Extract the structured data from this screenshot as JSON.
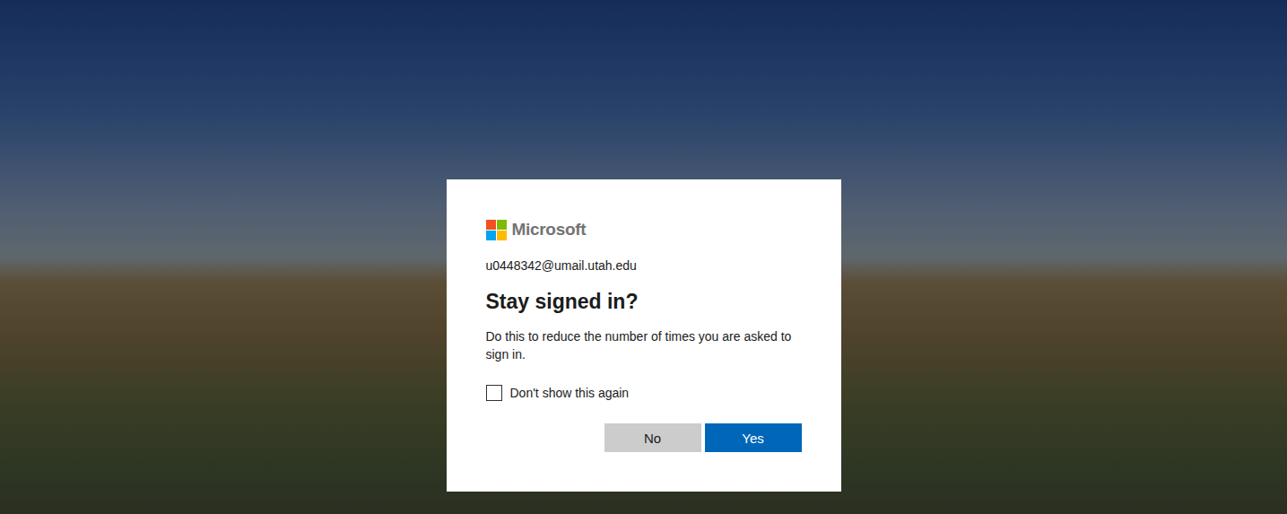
{
  "brand": {
    "name": "Microsoft"
  },
  "account": {
    "email": "u0448342@umail.utah.edu"
  },
  "dialog": {
    "title": "Stay signed in?",
    "description": "Do this to reduce the number of times you are asked to sign in."
  },
  "checkbox": {
    "label": "Don't show this again",
    "checked": false
  },
  "buttons": [
    {
      "label": "No",
      "kind": "secondary"
    },
    {
      "label": "Yes",
      "kind": "primary"
    }
  ]
}
